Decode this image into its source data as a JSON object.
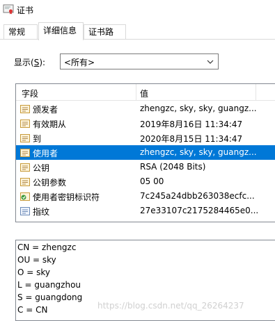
{
  "window": {
    "title": "证书"
  },
  "tabs": [
    {
      "label": "常规"
    },
    {
      "label": "详细信息"
    },
    {
      "label": "证书路径"
    }
  ],
  "show": {
    "label_prefix": "显示(",
    "label_key": "S",
    "label_suffix": "):",
    "value": "<所有>"
  },
  "list": {
    "col_field": "字段",
    "col_value": "值",
    "rows": [
      {
        "field": "颁发者",
        "value": "zhengzc, sky, sky, guangz...",
        "icon": "cert-field-icon"
      },
      {
        "field": "有效期从",
        "value": "2019年8月16日 11:34:47",
        "icon": "cert-field-icon"
      },
      {
        "field": "到",
        "value": "2020年8月15日 11:34:47",
        "icon": "cert-field-icon"
      },
      {
        "field": "使用者",
        "value": "zhengzc, sky, sky, guangz...",
        "icon": "cert-field-icon",
        "selected": true
      },
      {
        "field": "公钥",
        "value": "RSA (2048 Bits)",
        "icon": "cert-field-icon"
      },
      {
        "field": "公钥参数",
        "value": "05 00",
        "icon": "cert-field-icon"
      },
      {
        "field": "使用者密钥标识符",
        "value": "7c245a24dbb263038ecfc...",
        "icon": "cert-extension-icon"
      },
      {
        "field": "指纹",
        "value": "27e33107c2175284465e0...",
        "icon": "cert-property-icon"
      }
    ]
  },
  "details": {
    "lines": [
      "CN = zhengzc",
      "OU = sky",
      "O = sky",
      "L = guangzhou",
      "S = guangdong",
      "C = CN"
    ]
  },
  "watermark": "https://blog.csdn.net/qq_26264237",
  "colors": {
    "selection": "#0078d7",
    "border": "#828790"
  }
}
